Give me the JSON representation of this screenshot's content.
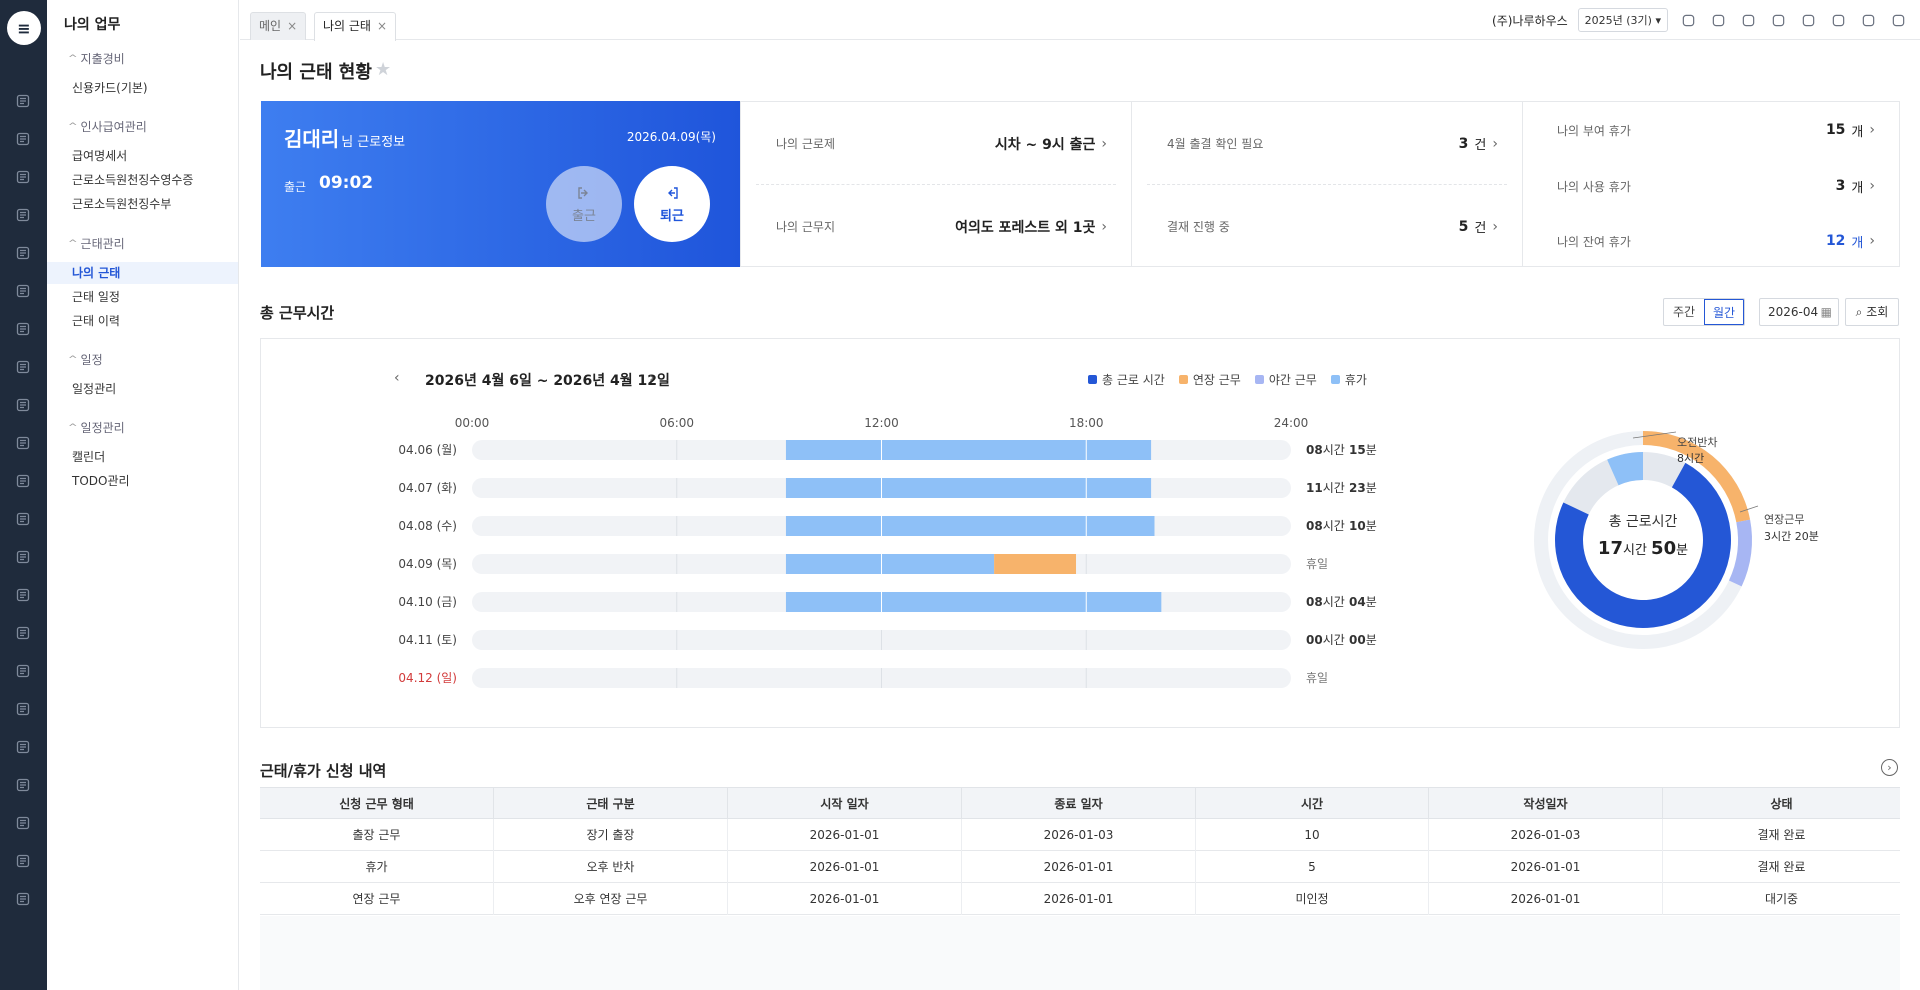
{
  "sidebar": {
    "title": "나의 업무",
    "groups": [
      {
        "label": "지출경비",
        "items": [
          {
            "label": "신용카드(기본)"
          }
        ]
      },
      {
        "label": "인사급여관리",
        "items": [
          {
            "label": "급여명세서"
          },
          {
            "label": "근로소득원천징수영수증"
          },
          {
            "label": "근로소득원천징수부"
          }
        ]
      },
      {
        "label": "근태관리",
        "items": [
          {
            "label": "나의 근태",
            "active": true
          },
          {
            "label": "근태 일정"
          },
          {
            "label": "근태 이력"
          }
        ]
      },
      {
        "label": "일정",
        "items": [
          {
            "label": "일정관리"
          }
        ]
      },
      {
        "label": "일정관리",
        "items": [
          {
            "label": "캘린더"
          },
          {
            "label": "TODO관리"
          }
        ]
      }
    ]
  },
  "tabs": [
    {
      "label": "메인"
    },
    {
      "label": "나의 근태",
      "active": true
    }
  ],
  "header": {
    "company": "(주)나루하우스",
    "period": "2025년 (3기)"
  },
  "page": {
    "title": "나의 근태 현황"
  },
  "card": {
    "name": "김대리",
    "name_suffix": "님 근로정보",
    "date": "2026.04.09(목)",
    "checkin_label": "출근",
    "checkin_time": "09:02",
    "btn_in": "출근",
    "btn_out": "퇴근"
  },
  "info": {
    "work_type_label": "나의 근로제",
    "work_type": "시차 ~ 9시 출근",
    "work_place_label": "나의 근무지",
    "work_place": "여의도 포레스트 외 1곳",
    "confirm_label": "4월 출결 확인 필요",
    "confirm_count": "3",
    "confirm_unit": "건",
    "approval_label": "결재 진행 중",
    "approval_count": "5",
    "approval_unit": "건",
    "leave_granted_label": "나의 부여 휴가",
    "leave_granted": "15",
    "leave_used_label": "나의 사용 휴가",
    "leave_used": "3",
    "leave_left_label": "나의 잔여 휴가",
    "leave_left": "12",
    "leave_unit": "개"
  },
  "worktime": {
    "title": "총 근무시간",
    "view_weekly": "주간",
    "view_monthly": "월간",
    "date_value": "2026-04",
    "search_label": "조회",
    "range": "2026년 4월 6일 ~ 2026년 4월 12일"
  },
  "chart_data": [
    {
      "type": "bar",
      "orientation": "horizontal-timeline",
      "x_ticks": [
        "00:00",
        "06:00",
        "12:00",
        "18:00",
        "24:00"
      ],
      "legend": [
        {
          "name": "총 근로 시간",
          "color": "#2457d6"
        },
        {
          "name": "연장 근무",
          "color": "#f7b36b"
        },
        {
          "name": "야간 근무",
          "color": "#a7b6f3"
        },
        {
          "name": "휴가",
          "color": "#8ec0f7"
        }
      ],
      "rows": [
        {
          "day": "04.06 (월)",
          "segments": [
            {
              "start": 9.2,
              "end": 19.9,
              "kind": "휴가"
            }
          ],
          "total_h": "08",
          "total_m": "15",
          "holiday": false
        },
        {
          "day": "04.07 (화)",
          "segments": [
            {
              "start": 9.2,
              "end": 19.9,
              "kind": "휴가"
            }
          ],
          "total_h": "11",
          "total_m": "23",
          "holiday": false
        },
        {
          "day": "04.08 (수)",
          "segments": [
            {
              "start": 9.2,
              "end": 20.0,
              "kind": "휴가"
            }
          ],
          "total_h": "08",
          "total_m": "10",
          "holiday": false
        },
        {
          "day": "04.09 (목)",
          "segments": [
            {
              "start": 9.2,
              "end": 15.3,
              "kind": "휴가"
            },
            {
              "start": 15.3,
              "end": 17.7,
              "kind": "연장 근무"
            }
          ],
          "label": "휴일",
          "holiday": false
        },
        {
          "day": "04.10 (금)",
          "segments": [
            {
              "start": 9.2,
              "end": 20.2,
              "kind": "휴가"
            }
          ],
          "total_h": "08",
          "total_m": "04",
          "holiday": false
        },
        {
          "day": "04.11 (토)",
          "segments": [],
          "total_h": "00",
          "total_m": "00",
          "holiday": false
        },
        {
          "day": "04.12 (일)",
          "segments": [],
          "label": "휴일",
          "holiday": true
        }
      ],
      "unit_hour": "시간",
      "unit_min": "분"
    },
    {
      "type": "pie",
      "center_title": "총 근로시간",
      "center_h": "17",
      "center_m": "50",
      "unit_hour": "시간",
      "unit_min": "분",
      "inner": [
        {
          "name": "총 근로 시간",
          "share": 0.74,
          "color": "#2457d6"
        },
        {
          "name": "휴가",
          "share": 0.07,
          "color": "#8ec0f7"
        }
      ],
      "outer": [
        {
          "name": "오전반차",
          "value_text": "8시간",
          "share": 0.22,
          "color": "#f7b36b"
        },
        {
          "name": "연장근무",
          "value_text": "3시간 20분",
          "share": 0.1,
          "color": "#a7b6f3"
        }
      ]
    }
  ],
  "requests": {
    "title": "근태/휴가 신청 내역",
    "columns": [
      "신청 근무 형태",
      "근태 구분",
      "시작 일자",
      "종료 일자",
      "시간",
      "작성일자",
      "상태"
    ],
    "rows": [
      [
        "출장 근무",
        "장기 출장",
        "2026-01-01",
        "2026-01-03",
        "10",
        "2026-01-03",
        "결재 완료"
      ],
      [
        "휴가",
        "오후 반차",
        "2026-01-01",
        "2026-01-01",
        "5",
        "2026-01-01",
        "결재 완료"
      ],
      [
        "연장 근무",
        "오후 연장 근무",
        "2026-01-01",
        "2026-01-01",
        "미인정",
        "2026-01-01",
        "대기중"
      ]
    ]
  },
  "icons": {
    "rail": [
      "chart-icon",
      "coin-icon",
      "bank-icon",
      "calculator-icon",
      "cart-icon",
      "my-icon",
      "pie-icon",
      "gear-icon",
      "card-icon",
      "receipt-icon",
      "store-icon",
      "box-icon",
      "doc-icon",
      "building-icon",
      "person-icon",
      "cube-icon",
      "briefcase-icon",
      "file-check-icon",
      "file-icon",
      "edit-icon",
      "calendar-icon",
      "list-icon"
    ],
    "header": [
      "clipboard-icon",
      "help-icon",
      "download-icon",
      "headset-icon",
      "chat-icon",
      "bell-icon",
      "org-chart-icon",
      "profile-icon"
    ]
  }
}
